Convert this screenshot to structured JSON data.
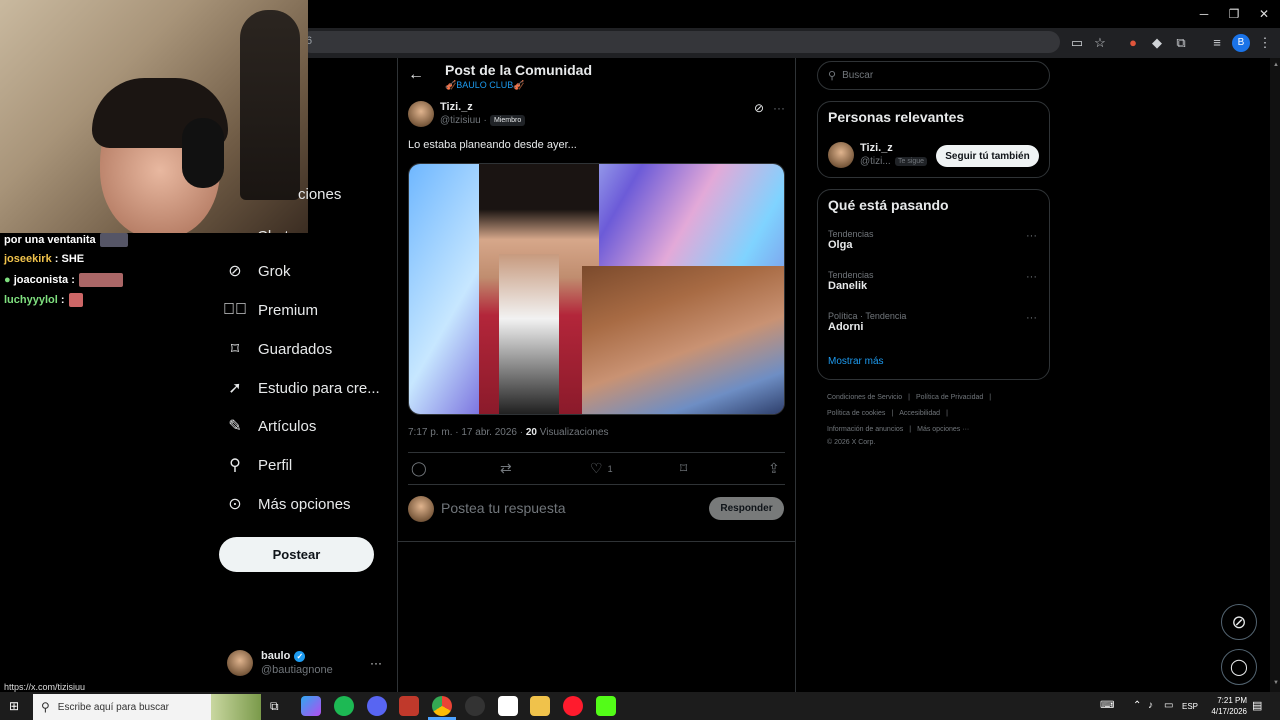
{
  "browser": {
    "url_fragment": "6"
  },
  "chat": [
    {
      "user": "",
      "msg": "por una ventanita",
      "color": "#ffffff"
    },
    {
      "user": "joseekirk",
      "msg": ": SHE",
      "color": "#f0c24b"
    },
    {
      "user": "joaconista",
      "msg": ":",
      "color": "#7fe07f"
    },
    {
      "user": "luchyyylol",
      "msg": ":",
      "color": "#7fe07f"
    }
  ],
  "nav": {
    "partial_item": "ciones",
    "chat": "Chat",
    "items": [
      "Grok",
      "Premium",
      "Guardados",
      "Estudio para cre...",
      "Artículos",
      "Perfil",
      "Más opciones"
    ],
    "post": "Postear"
  },
  "account": {
    "name": "baulo",
    "handle": "@bautiagnone"
  },
  "status_url": "https://x.com/tizisiuu",
  "header": {
    "title": "Post de la Comunidad",
    "community": "🎻BAULO CLUB🎻"
  },
  "post": {
    "name": "Tizi._z",
    "handle": "@tizisiuu ·",
    "badge": "Miembro",
    "text": "Lo estaba planeando desde ayer...",
    "time": "7:17 p. m. · 17 abr. 2026 ·",
    "views_count": "20",
    "views_label": "Visualizaciones",
    "likes": "1"
  },
  "reply": {
    "placeholder": "Postea tu respuesta",
    "button": "Responder"
  },
  "search": {
    "placeholder": "Buscar"
  },
  "relevant": {
    "title": "Personas relevantes",
    "name": "Tizi._z",
    "handle": "@tizi...",
    "follows_you": "Te sigue",
    "follow_button": "Seguir tú también"
  },
  "trends": {
    "title": "Qué está pasando",
    "items": [
      {
        "meta": "Tendencias",
        "name": "Olga"
      },
      {
        "meta": "Tendencias",
        "name": "Danelik"
      },
      {
        "meta": "Política · Tendencia",
        "name": "Adorni"
      }
    ],
    "more": "Mostrar más"
  },
  "footer": {
    "line1a": "Condiciones de Servicio",
    "line1b": "Política de Privacidad",
    "line2a": "Política de cookies",
    "line2b": "Accesibilidad",
    "line3a": "Información de anuncios",
    "line3b": "Más opciones ···",
    "copyright": "© 2026 X Corp."
  },
  "taskbar": {
    "search": "Escribe aquí para buscar",
    "lang": "ESP",
    "time": "7:21 PM",
    "date": "4/17/2026"
  }
}
